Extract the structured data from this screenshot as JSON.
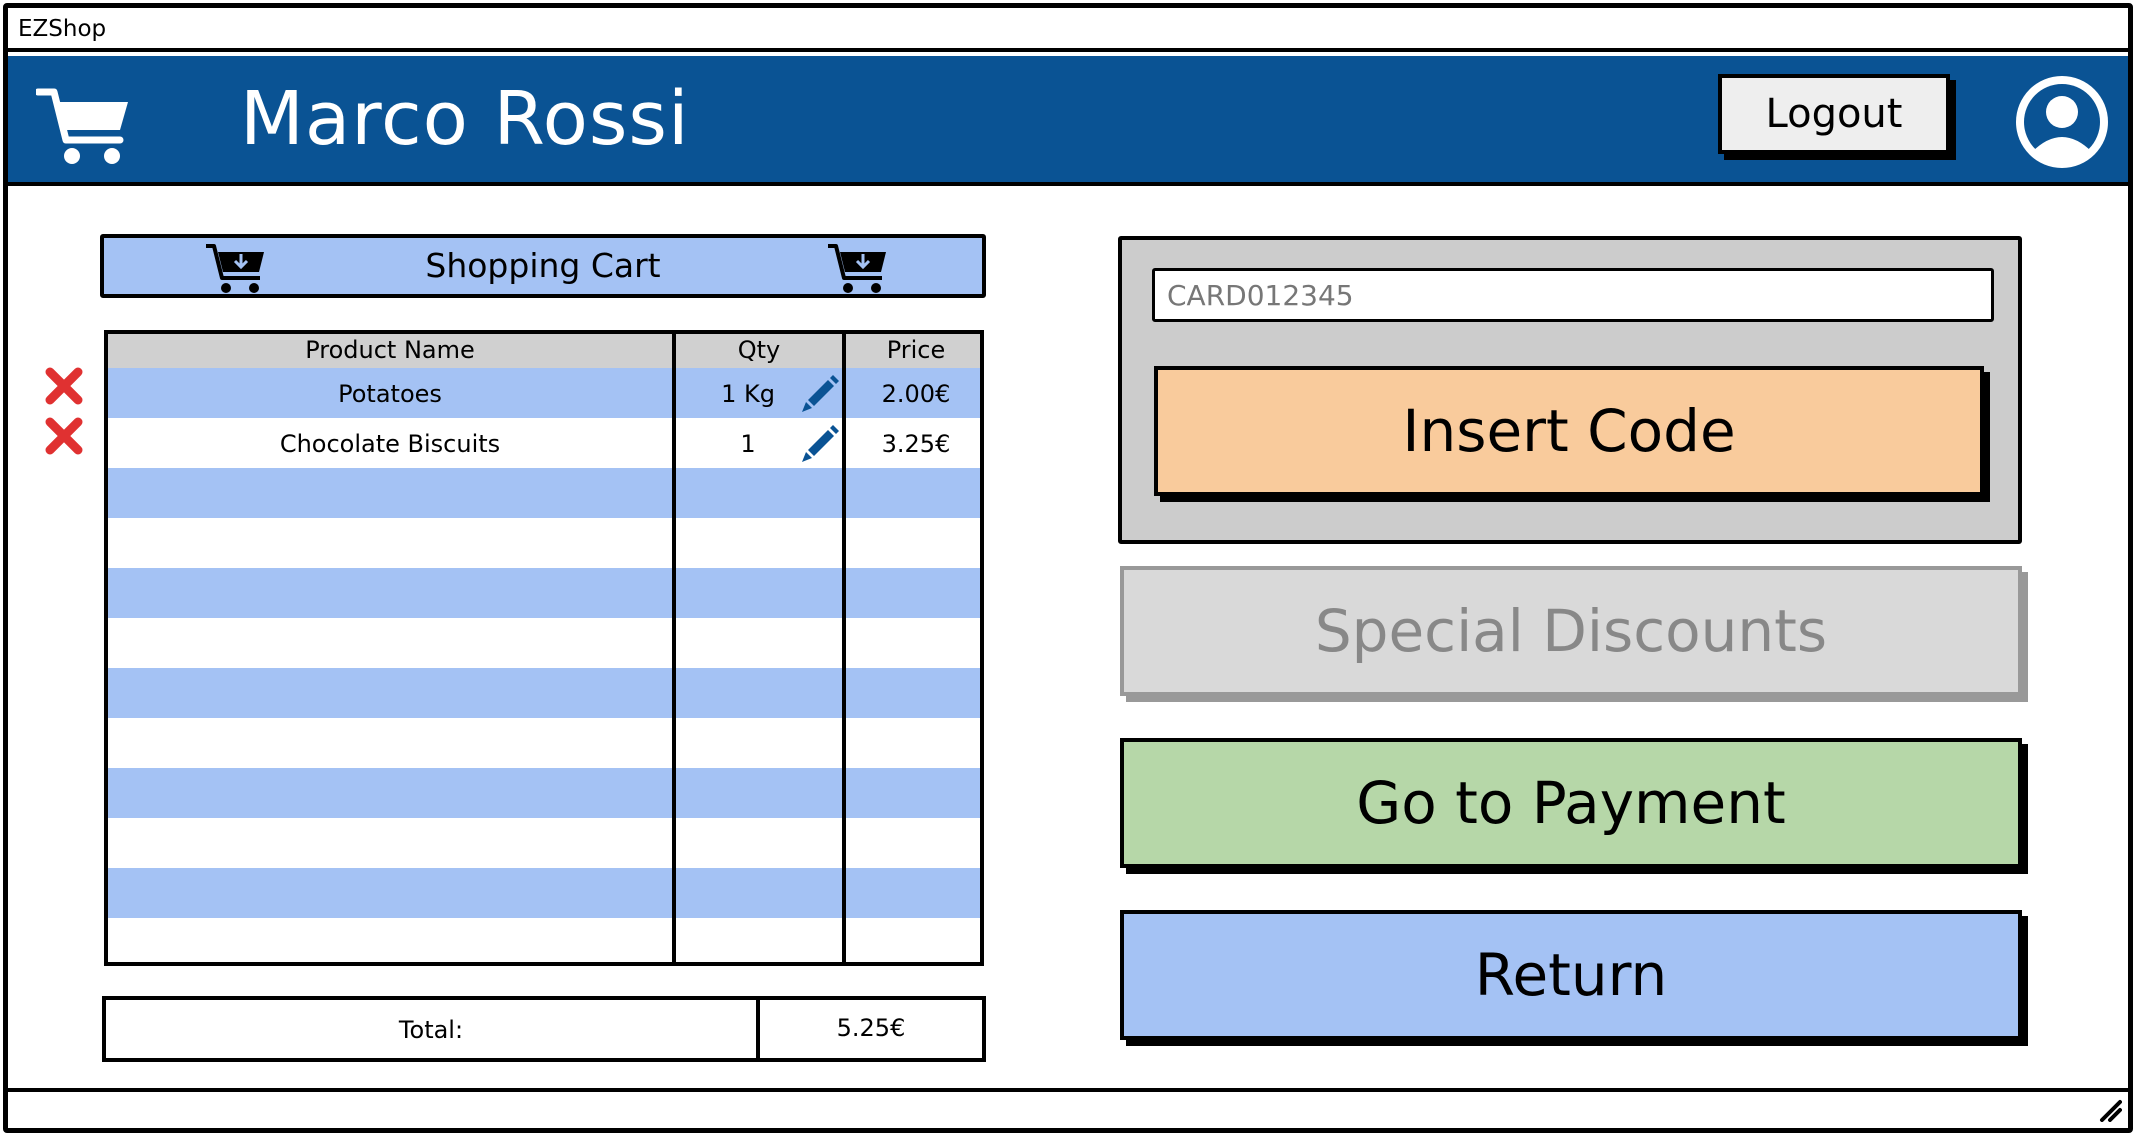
{
  "window": {
    "title": "EZShop"
  },
  "header": {
    "user_name": "Marco Rossi",
    "logout_label": "Logout",
    "cart_icon": "shopping-cart-icon",
    "avatar_icon": "user-avatar-icon"
  },
  "cart": {
    "title": "Shopping Cart",
    "columns": [
      "Product Name",
      "Qty",
      "Price"
    ],
    "items": [
      {
        "name": "Potatoes",
        "qty": "1 Kg",
        "price": "2.00€"
      },
      {
        "name": "Chocolate Biscuits",
        "qty": "1",
        "price": "3.25€"
      }
    ],
    "total_label": "Total:",
    "total_value": "5.25€"
  },
  "code_panel": {
    "card_value": "CARD012345",
    "insert_label": "Insert Code"
  },
  "actions": {
    "special_label": "Special Discounts",
    "payment_label": "Go to Payment",
    "return_label": "Return"
  },
  "colors": {
    "header_bg": "#0a5394",
    "row_blue": "#a4c2f4",
    "insert_bg": "#f9cb9c",
    "payment_bg": "#b6d7a8",
    "return_bg": "#a4c2f4",
    "disabled_bg": "#d9d9d9",
    "delete_red": "#e03131",
    "pencil_blue": "#0a5394"
  }
}
